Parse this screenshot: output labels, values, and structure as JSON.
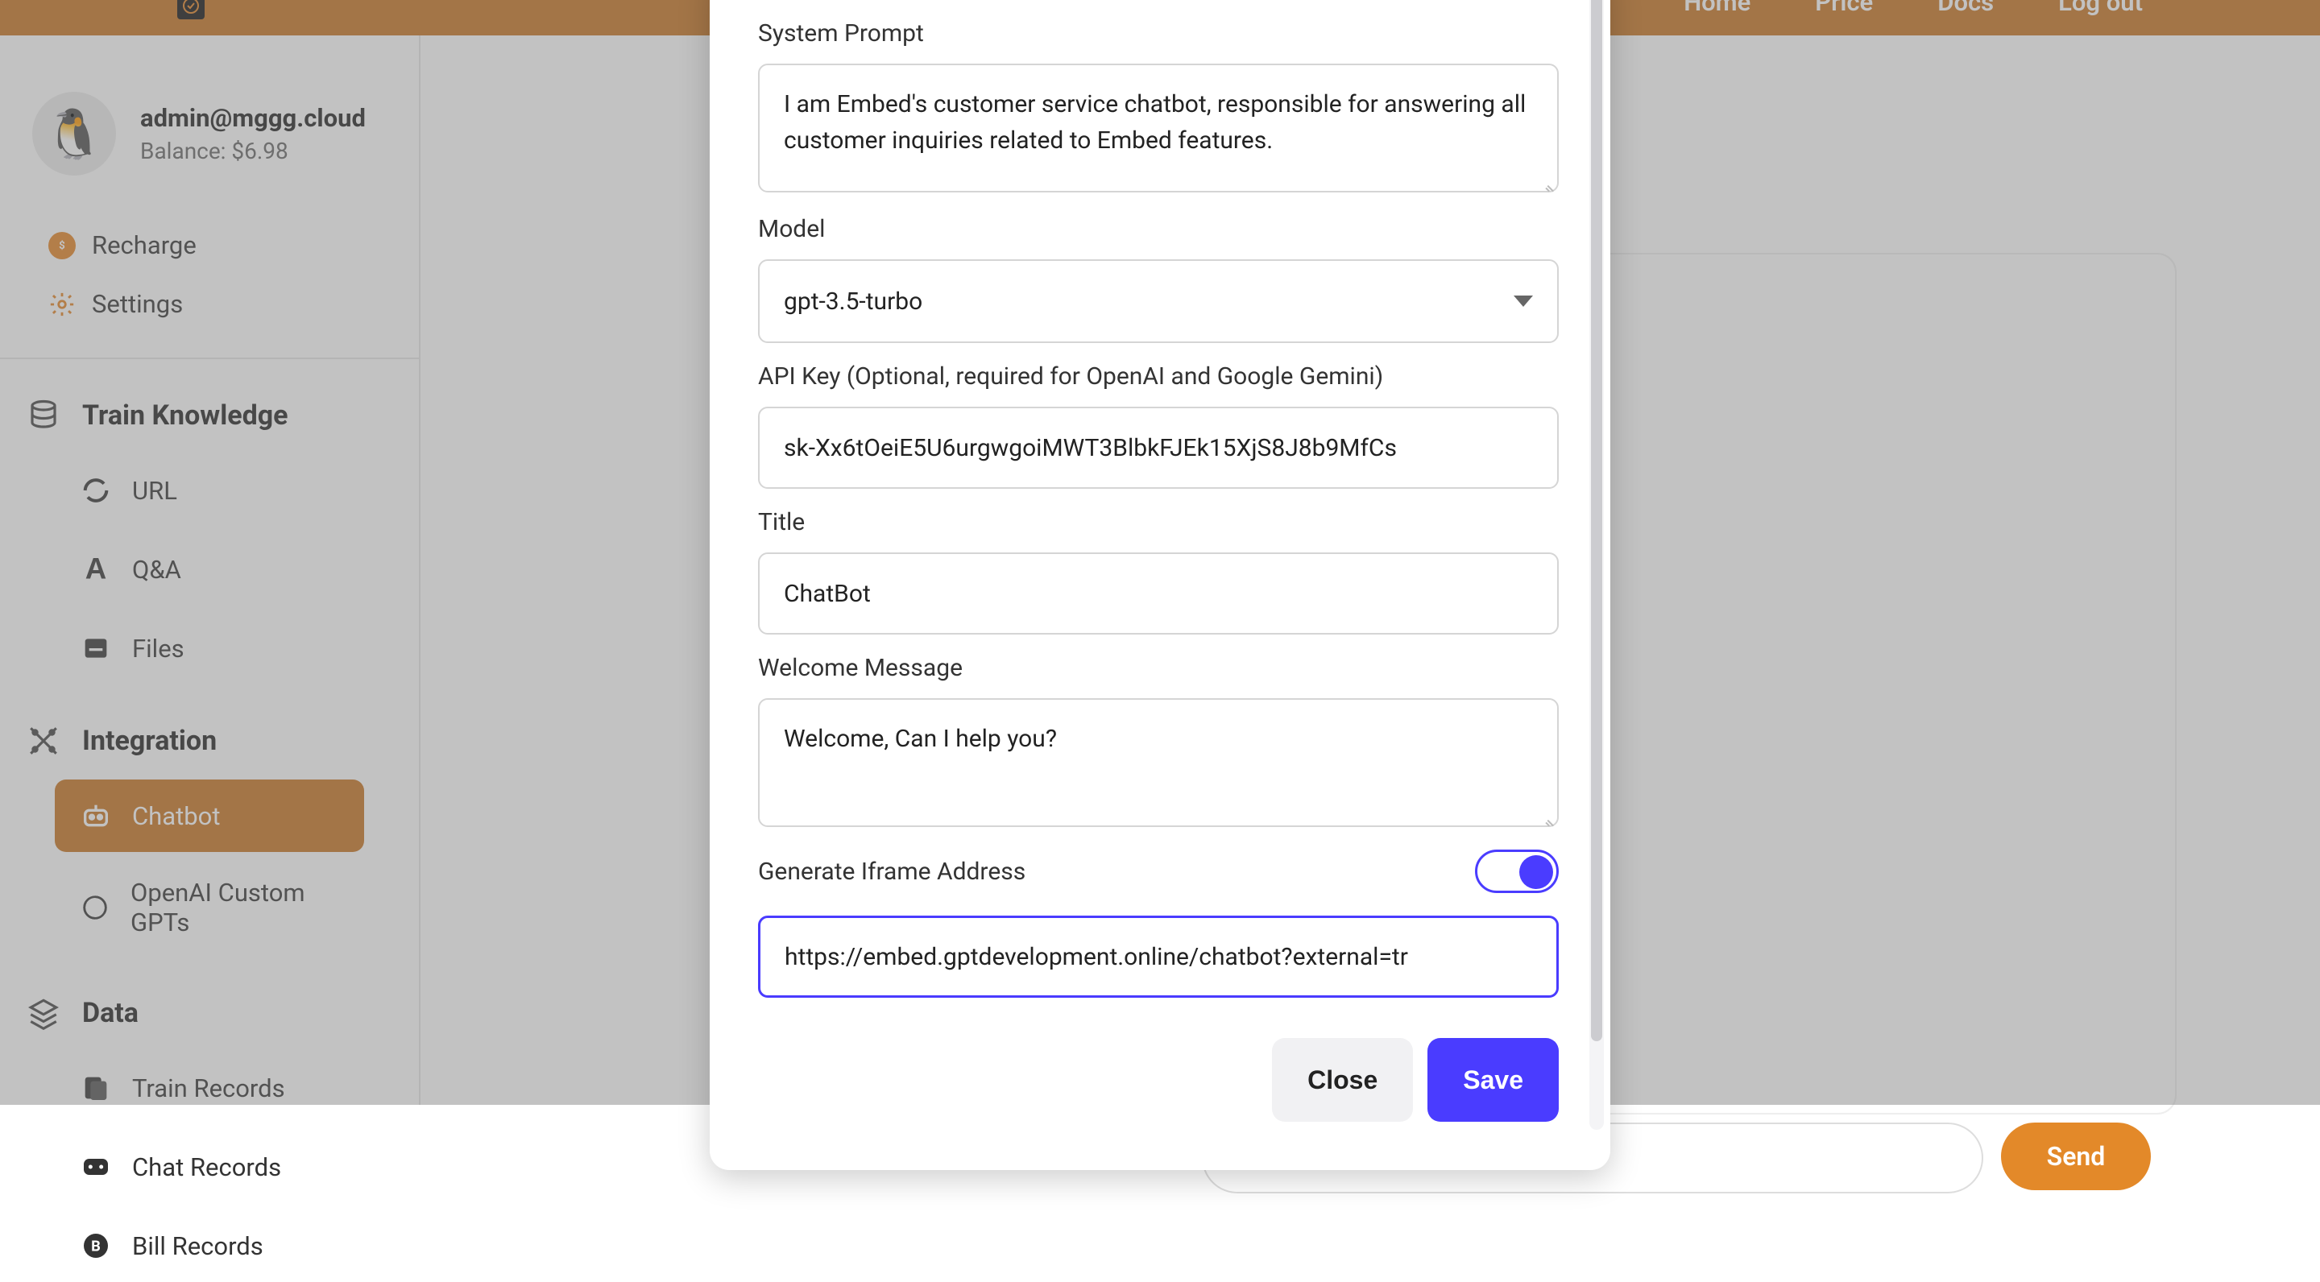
{
  "header": {
    "nav": [
      "Home",
      "Price",
      "Docs",
      "Log out"
    ]
  },
  "user": {
    "email": "admin@mggg.cloud",
    "balance_label": "Balance: $6.98",
    "avatar_emoji": "🐧"
  },
  "account_links": {
    "recharge": "Recharge",
    "settings": "Settings"
  },
  "sections": {
    "train": {
      "title": "Train Knowledge",
      "items": [
        "URL",
        "Q&A",
        "Files"
      ]
    },
    "integration": {
      "title": "Integration",
      "items": [
        "Chatbot",
        "OpenAI Custom GPTs"
      ],
      "active_index": 0
    },
    "data": {
      "title": "Data",
      "items": [
        "Train Records",
        "Chat Records",
        "Bill Records"
      ]
    }
  },
  "chat": {
    "send_label": "Send"
  },
  "modal": {
    "system_prompt_label": "System Prompt",
    "system_prompt_value": "I am Embed's customer service chatbot, responsible for answering all customer inquiries related to Embed features.",
    "model_label": "Model",
    "model_value": "gpt-3.5-turbo",
    "api_key_label": "API Key (Optional, required for OpenAI and Google Gemini)",
    "api_key_value": "sk-Xx6tOeiE5U6urgwgoiMWT3BlbkFJEk15XjS8J8b9MfCs",
    "title_label": "Title",
    "title_value": "ChatBot",
    "welcome_label": "Welcome Message",
    "welcome_value": "Welcome, Can I help you?",
    "iframe_label": "Generate Iframe Address",
    "iframe_url": "https://embed.gptdevelopment.online/chatbot?external=tr",
    "close_label": "Close",
    "save_label": "Save",
    "iframe_toggle_on": true
  }
}
